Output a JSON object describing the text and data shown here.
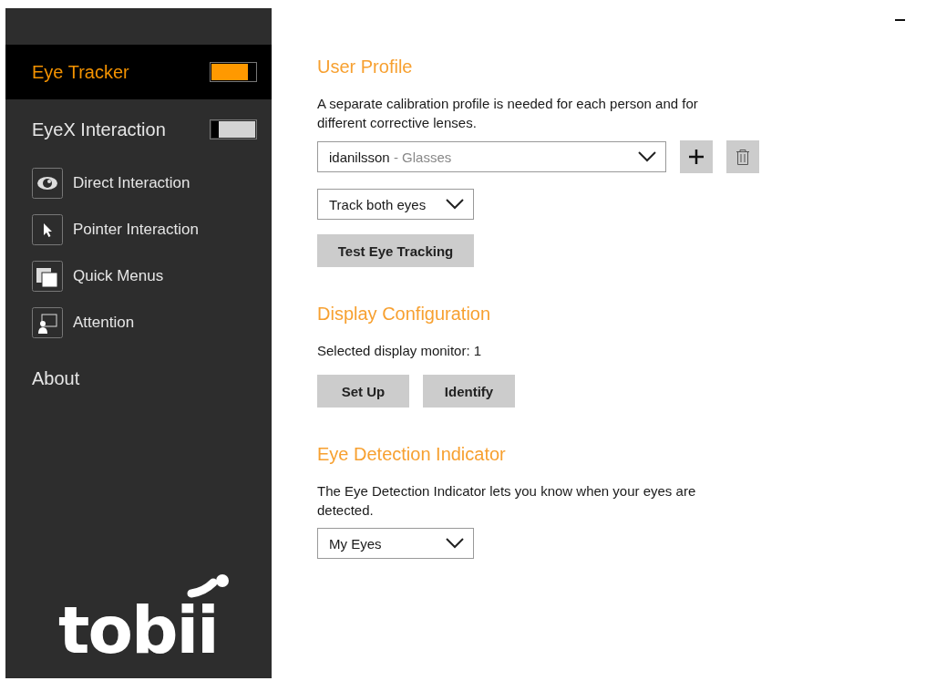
{
  "sidebar": {
    "items": [
      {
        "kind": "toggle",
        "label": "Eye Tracker",
        "selected": true,
        "on": true
      },
      {
        "kind": "toggle",
        "label": "EyeX Interaction",
        "selected": false,
        "on": false
      },
      {
        "kind": "sub",
        "label": "Direct Interaction",
        "selected": false
      },
      {
        "kind": "sub",
        "label": "Pointer Interaction",
        "selected": false
      },
      {
        "kind": "sub",
        "label": "Quick Menus",
        "selected": false
      },
      {
        "kind": "sub",
        "label": "Attention",
        "selected": false
      },
      {
        "kind": "plain",
        "label": "About",
        "selected": false
      }
    ],
    "logo": "tobii"
  },
  "sections": [
    {
      "title": "User Profile",
      "parts": [
        {
          "kind": "text",
          "text": "A separate calibration profile is needed for each person and for different corrective lenses."
        },
        {
          "kind": "profile",
          "value": "idanilsson",
          "detail": "- Glasses"
        },
        {
          "kind": "dropdown",
          "value": "Track both eyes"
        },
        {
          "kind": "buttons",
          "buttons": [
            "Test Eye Tracking"
          ]
        }
      ]
    },
    {
      "title": "Display Configuration",
      "parts": [
        {
          "kind": "text",
          "text": "Selected display monitor: 1"
        },
        {
          "kind": "buttons",
          "buttons": [
            "Set Up",
            "Identify"
          ]
        }
      ]
    },
    {
      "title": "Eye Detection Indicator",
      "parts": [
        {
          "kind": "text",
          "text": "The Eye Detection Indicator lets you know when your eyes are detected."
        },
        {
          "kind": "dropdown",
          "value": "My Eyes"
        }
      ]
    }
  ]
}
